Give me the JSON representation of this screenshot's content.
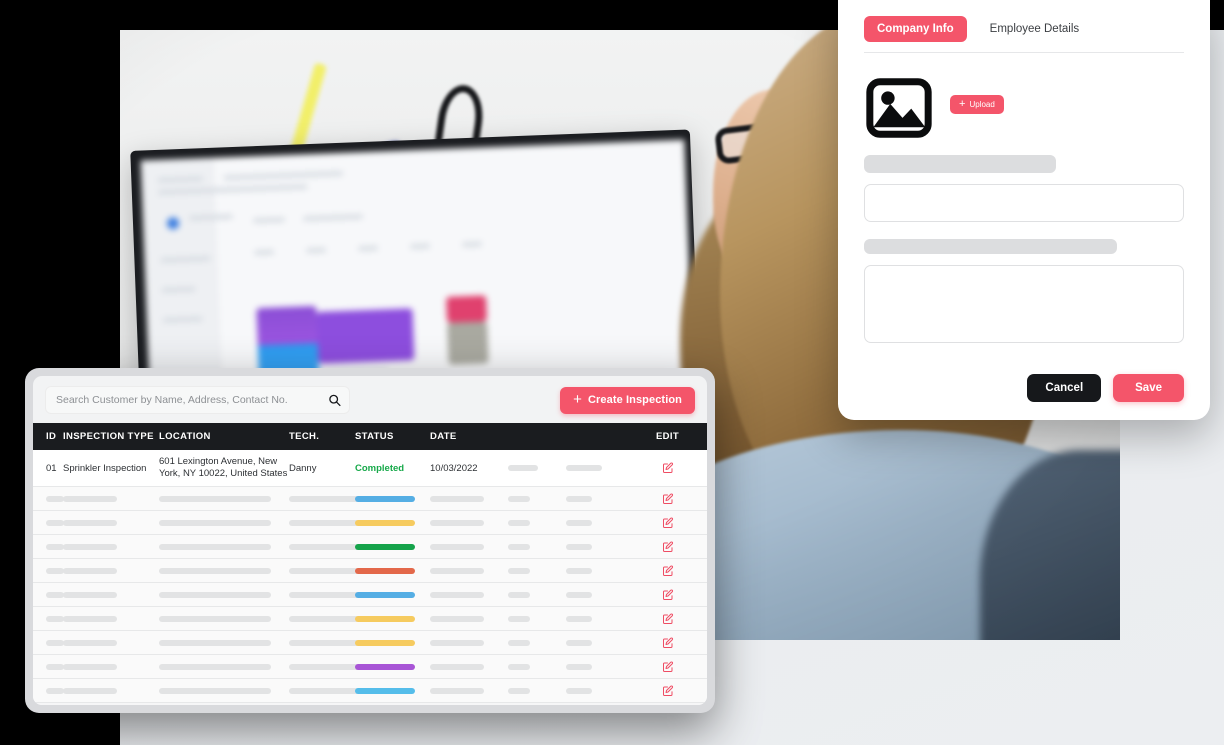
{
  "table_panel": {
    "search": {
      "placeholder": "Search Customer by Name, Address, Contact No.",
      "value": "",
      "icon": "search-icon"
    },
    "create_button": {
      "label": "Create Inspection",
      "icon": "plus-icon",
      "color": "#F4556A"
    },
    "columns": [
      {
        "key": "id",
        "label": "ID"
      },
      {
        "key": "type",
        "label": "INSPECTION TYPE"
      },
      {
        "key": "loc",
        "label": "LOCATION"
      },
      {
        "key": "tech",
        "label": "TECH."
      },
      {
        "key": "status",
        "label": "STATUS"
      },
      {
        "key": "date",
        "label": "DATE"
      },
      {
        "key": "extra1",
        "label": ""
      },
      {
        "key": "extra2",
        "label": ""
      },
      {
        "key": "edit",
        "label": "EDIT"
      }
    ],
    "first_row": {
      "id": "01",
      "type": "Sprinkler Inspection",
      "location_line1": "601 Lexington Avenue, New",
      "location_line2": "York, NY 10022, United States",
      "tech": "Danny",
      "status": "Completed",
      "status_color": "#17A94A",
      "date": "10/03/2022",
      "edit_icon": "edit-pencil-icon"
    },
    "placeholder_rows": [
      {
        "status_color": "#55AEE4"
      },
      {
        "status_color": "#F6CB5F"
      },
      {
        "status_color": "#15A34A"
      },
      {
        "status_color": "#E3684A"
      },
      {
        "status_color": "#55AEE4"
      },
      {
        "status_color": "#F6CB5F"
      },
      {
        "status_color": "#F6CB5F"
      },
      {
        "status_color": "#A855D6"
      },
      {
        "status_color": "#55BDEA"
      }
    ],
    "edit_icon_color": "#EF4C63"
  },
  "form_panel": {
    "tabs": [
      {
        "label": "Company Info",
        "active": true
      },
      {
        "label": "Employee Details",
        "active": false
      }
    ],
    "image_placeholder_icon": "image-placeholder-icon",
    "upload_button": {
      "label": "Upload",
      "icon": "plus-icon",
      "color": "#F4556A"
    },
    "field_1": {
      "value": "",
      "placeholder": ""
    },
    "field_2": {
      "value": "",
      "placeholder": ""
    },
    "cancel_button": {
      "label": "Cancel",
      "color": "#16181B"
    },
    "save_button": {
      "label": "Save",
      "color": "#F4556A"
    }
  }
}
